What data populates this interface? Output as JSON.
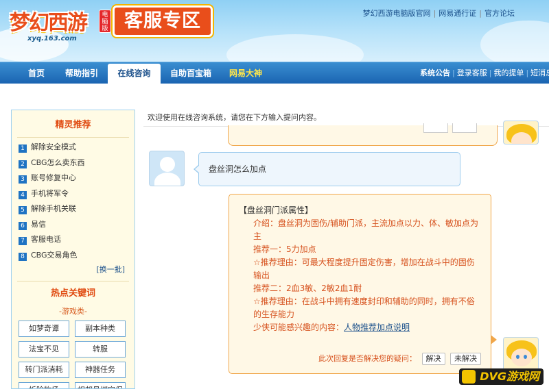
{
  "header": {
    "logo_text": "梦幻西游",
    "logo_badge": "电脑版",
    "logo_url": "xyq.163.com",
    "zone_title": "客服专区",
    "top_links": [
      "梦幻西游电脑版官网",
      "网易通行证",
      "官方论坛"
    ]
  },
  "nav": {
    "tabs": [
      {
        "label": "首页"
      },
      {
        "label": "帮助指引"
      },
      {
        "label": "在线咨询"
      },
      {
        "label": "自助百宝箱"
      },
      {
        "label": "网易大神"
      }
    ],
    "right_links": [
      "系统公告",
      "登录客服",
      "我的提单",
      "短消息"
    ]
  },
  "sidebar": {
    "recommend_title": "精灵推荐",
    "recommend_items": [
      {
        "num": "1",
        "label": "解除安全模式"
      },
      {
        "num": "2",
        "label": "CBG怎么卖东西"
      },
      {
        "num": "3",
        "label": "账号修复中心"
      },
      {
        "num": "4",
        "label": "手机将军令"
      },
      {
        "num": "5",
        "label": "解除手机关联"
      },
      {
        "num": "6",
        "label": "易信"
      },
      {
        "num": "7",
        "label": "客服电话"
      },
      {
        "num": "8",
        "label": "CBG交易角色"
      }
    ],
    "refresh_label": "[换一批]",
    "keywords_title": "热点关键词",
    "category_label": "-游戏类-",
    "keywords": [
      "如梦奇谭",
      "副本种类",
      "法宝不见",
      "转服",
      "转门派消耗",
      "神器任务",
      "拆除牧场",
      "相邦号绑定保"
    ]
  },
  "chat": {
    "welcome": "欢迎使用在线咨询系统，请您在下方输入提问内容。",
    "user_question": "盘丝洞怎么加点",
    "answer": {
      "title": "【盘丝洞门派属性】",
      "intro": "介绍：盘丝洞为固伤/辅助门派，主流加点以力、体、敏加点为主",
      "rec1": "推荐一：5力加点",
      "reason1": "☆推荐理由：可最大程度提升固定伤害，增加在战斗中的固伤输出",
      "rec2": "推荐二：2血3敏、2敏2血1耐",
      "reason2": "☆推荐理由：在战斗中拥有速度封印和辅助的同时，拥有不俗的生存能力",
      "more_prefix": "少侠可能感兴趣的内容：",
      "more_link": "人物推荐加点说明"
    },
    "feedback_question": "此次回复是否解决您的疑问：",
    "solved_label": "解决",
    "unsolved_label": "未解决"
  },
  "watermark": "DVG游戏网"
}
